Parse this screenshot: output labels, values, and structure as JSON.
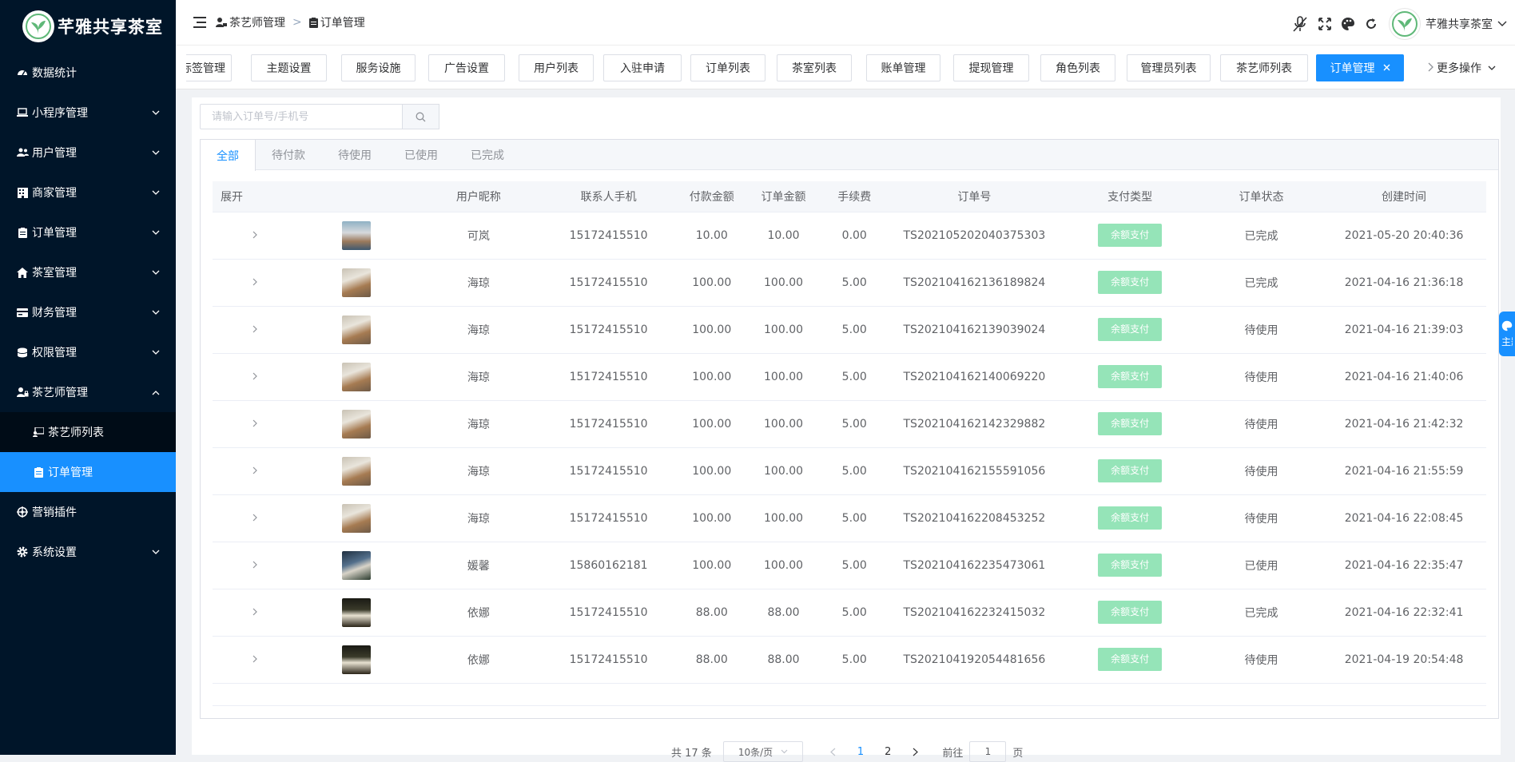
{
  "app": {
    "name": "芊雅共享茶室"
  },
  "colors": {
    "sidebar_bg": "#001529",
    "accent": "#1890ff",
    "pay_badge": "#95e4b8"
  },
  "sidebar": {
    "items": [
      {
        "label": "数据统计",
        "icon": "dashboard-icon",
        "caret": false
      },
      {
        "label": "小程序管理",
        "icon": "laptop-icon",
        "caret": true
      },
      {
        "label": "用户管理",
        "icon": "users-icon",
        "caret": true
      },
      {
        "label": "商家管理",
        "icon": "building-icon",
        "caret": true
      },
      {
        "label": "订单管理",
        "icon": "clipboard-icon",
        "caret": true
      },
      {
        "label": "茶室管理",
        "icon": "home-icon",
        "caret": true
      },
      {
        "label": "财务管理",
        "icon": "card-icon",
        "caret": true
      },
      {
        "label": "权限管理",
        "icon": "coins-icon",
        "caret": true
      },
      {
        "label": "茶艺师管理",
        "icon": "user-lock-icon",
        "caret": "up"
      },
      {
        "label": "茶艺师列表",
        "icon": "teacher-icon",
        "sub": true
      },
      {
        "label": "订单管理",
        "icon": "clipboard-icon",
        "sub": true,
        "active": true
      },
      {
        "label": "营销插件",
        "icon": "dharma-icon",
        "caret": false
      },
      {
        "label": "系统设置",
        "icon": "gear-icon",
        "caret": true
      }
    ]
  },
  "breadcrumb": {
    "parent": "茶艺师管理",
    "current": "订单管理",
    "separator": ">"
  },
  "header": {
    "user_name": "芊雅共享茶室"
  },
  "tags": [
    {
      "label": "标签管理"
    },
    {
      "label": "主题设置"
    },
    {
      "label": "服务设施"
    },
    {
      "label": "广告设置"
    },
    {
      "label": "用户列表"
    },
    {
      "label": "入驻申请"
    },
    {
      "label": "订单列表"
    },
    {
      "label": "茶室列表"
    },
    {
      "label": "账单管理"
    },
    {
      "label": "提现管理"
    },
    {
      "label": "角色列表"
    },
    {
      "label": "管理员列表"
    },
    {
      "label": "茶艺师列表"
    },
    {
      "label": "订单管理",
      "active": true
    }
  ],
  "more_ops": "更多操作",
  "search": {
    "placeholder": "请输入订单号/手机号"
  },
  "order_tabs": [
    "全部",
    "待付款",
    "待使用",
    "已使用",
    "已完成"
  ],
  "table": {
    "headers": [
      "展开",
      "",
      "用户昵称",
      "联系人手机",
      "付款金额",
      "订单金额",
      "手续费",
      "订单号",
      "支付类型",
      "订单状态",
      "创建时间"
    ],
    "rows": [
      {
        "thumb": "t1",
        "nickname": "可岚",
        "phone": "15172415510",
        "paid": "10.00",
        "amount": "10.00",
        "fee": "0.00",
        "order_no": "TS202105202040375303",
        "pay_type": "余额支付",
        "status": "已完成",
        "created": "2021-05-20 20:40:36"
      },
      {
        "thumb": "t2",
        "nickname": "海琼",
        "phone": "15172415510",
        "paid": "100.00",
        "amount": "100.00",
        "fee": "5.00",
        "order_no": "TS202104162136189824",
        "pay_type": "余额支付",
        "status": "已完成",
        "created": "2021-04-16 21:36:18"
      },
      {
        "thumb": "t2",
        "nickname": "海琼",
        "phone": "15172415510",
        "paid": "100.00",
        "amount": "100.00",
        "fee": "5.00",
        "order_no": "TS202104162139039024",
        "pay_type": "余额支付",
        "status": "待使用",
        "created": "2021-04-16 21:39:03"
      },
      {
        "thumb": "t2",
        "nickname": "海琼",
        "phone": "15172415510",
        "paid": "100.00",
        "amount": "100.00",
        "fee": "5.00",
        "order_no": "TS202104162140069220",
        "pay_type": "余额支付",
        "status": "待使用",
        "created": "2021-04-16 21:40:06"
      },
      {
        "thumb": "t2",
        "nickname": "海琼",
        "phone": "15172415510",
        "paid": "100.00",
        "amount": "100.00",
        "fee": "5.00",
        "order_no": "TS202104162142329882",
        "pay_type": "余额支付",
        "status": "待使用",
        "created": "2021-04-16 21:42:32"
      },
      {
        "thumb": "t2",
        "nickname": "海琼",
        "phone": "15172415510",
        "paid": "100.00",
        "amount": "100.00",
        "fee": "5.00",
        "order_no": "TS202104162155591056",
        "pay_type": "余额支付",
        "status": "待使用",
        "created": "2021-04-16 21:55:59"
      },
      {
        "thumb": "t2",
        "nickname": "海琼",
        "phone": "15172415510",
        "paid": "100.00",
        "amount": "100.00",
        "fee": "5.00",
        "order_no": "TS202104162208453252",
        "pay_type": "余额支付",
        "status": "待使用",
        "created": "2021-04-16 22:08:45"
      },
      {
        "thumb": "t3",
        "nickname": "媛馨",
        "phone": "15860162181",
        "paid": "100.00",
        "amount": "100.00",
        "fee": "5.00",
        "order_no": "TS202104162235473061",
        "pay_type": "余额支付",
        "status": "已使用",
        "created": "2021-04-16 22:35:47"
      },
      {
        "thumb": "t4",
        "nickname": "依娜",
        "phone": "15172415510",
        "paid": "88.00",
        "amount": "88.00",
        "fee": "5.00",
        "order_no": "TS202104162232415032",
        "pay_type": "余额支付",
        "status": "已完成",
        "created": "2021-04-16 22:32:41"
      },
      {
        "thumb": "t4",
        "nickname": "依娜",
        "phone": "15172415510",
        "paid": "88.00",
        "amount": "88.00",
        "fee": "5.00",
        "order_no": "TS202104192054481656",
        "pay_type": "余额支付",
        "status": "待使用",
        "created": "2021-04-19 20:54:48"
      }
    ]
  },
  "pagination": {
    "total": "共 17 条",
    "page_size": "10条/页",
    "pages": [
      "1",
      "2"
    ],
    "current": "1",
    "goto_prefix": "前往",
    "goto_value": "1",
    "goto_suffix": "页"
  },
  "side_tab": {
    "label": "主题"
  }
}
